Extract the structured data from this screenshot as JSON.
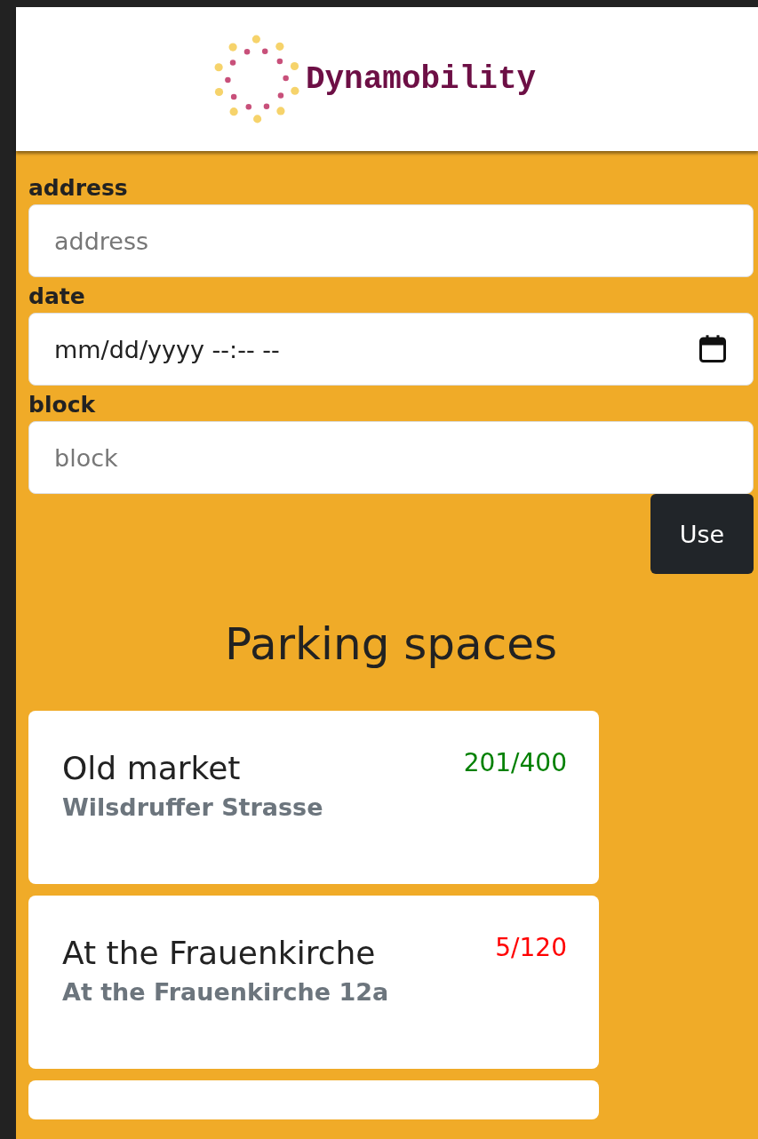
{
  "header": {
    "logo_text": "Dynamobility"
  },
  "form": {
    "fields": [
      {
        "label": "address",
        "kind": "text",
        "placeholder": "address"
      },
      {
        "label": "date",
        "kind": "datetime",
        "placeholder": "mm/dd/yyyy --:-- --"
      },
      {
        "label": "block",
        "kind": "text",
        "placeholder": "block"
      }
    ],
    "button": "Use"
  },
  "section_title": "Parking spaces",
  "parking_spaces": [
    {
      "name": "Old market",
      "address": "Wilsdruffer Strasse",
      "count": "201/400",
      "color": "#008000"
    },
    {
      "name": "At the Frauenkirche",
      "address": "At the Frauenkirche 12a",
      "count": "5/120",
      "color": "#ff0000"
    }
  ]
}
